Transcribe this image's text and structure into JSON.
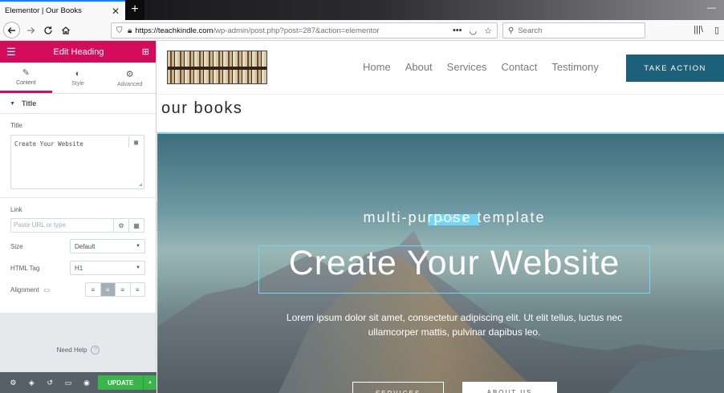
{
  "browser": {
    "tab_title": "Elementor | Our Books",
    "tab_close": "✕",
    "new_tab": "+",
    "url_host": "https://teachkindle.com",
    "url_path": "/wp-admin/post.php?post=287&action=elementor",
    "search_placeholder": "Search"
  },
  "panel": {
    "header_title": "Edit Heading",
    "tabs": [
      {
        "label": "Content"
      },
      {
        "label": "Style"
      },
      {
        "label": "Advanced"
      }
    ],
    "section_title": "Title",
    "title_label": "Title",
    "title_value": "Create Your Website",
    "link_label": "Link",
    "link_placeholder": "Paste URL or type",
    "size_label": "Size",
    "size_value": "Default",
    "html_tag_label": "HTML Tag",
    "html_tag_value": "H1",
    "alignment_label": "Alignment",
    "need_help": "Need Help",
    "update_label": "UPDATE"
  },
  "site": {
    "nav": [
      "Home",
      "About",
      "Services",
      "Contact",
      "Testimony"
    ],
    "cta_label": "TAKE ACTION",
    "page_heading": "our books",
    "hero_subtitle": "multi-purpose template",
    "hero_title": "Create Your Website",
    "hero_body_line1": "Lorem ipsum dolor sit amet, consectetur adipiscing elit. Ut elit tellus, luctus nec",
    "hero_body_line2": "ullamcorper mattis, pulvinar dapibus leo.",
    "btn_services": "SERVICES",
    "btn_about": "ABOUT US"
  },
  "colors": {
    "elementor_pink": "#d30c5c",
    "cta_teal": "#1d6079",
    "update_green": "#39b54a",
    "selection_blue": "#71d7f7"
  }
}
